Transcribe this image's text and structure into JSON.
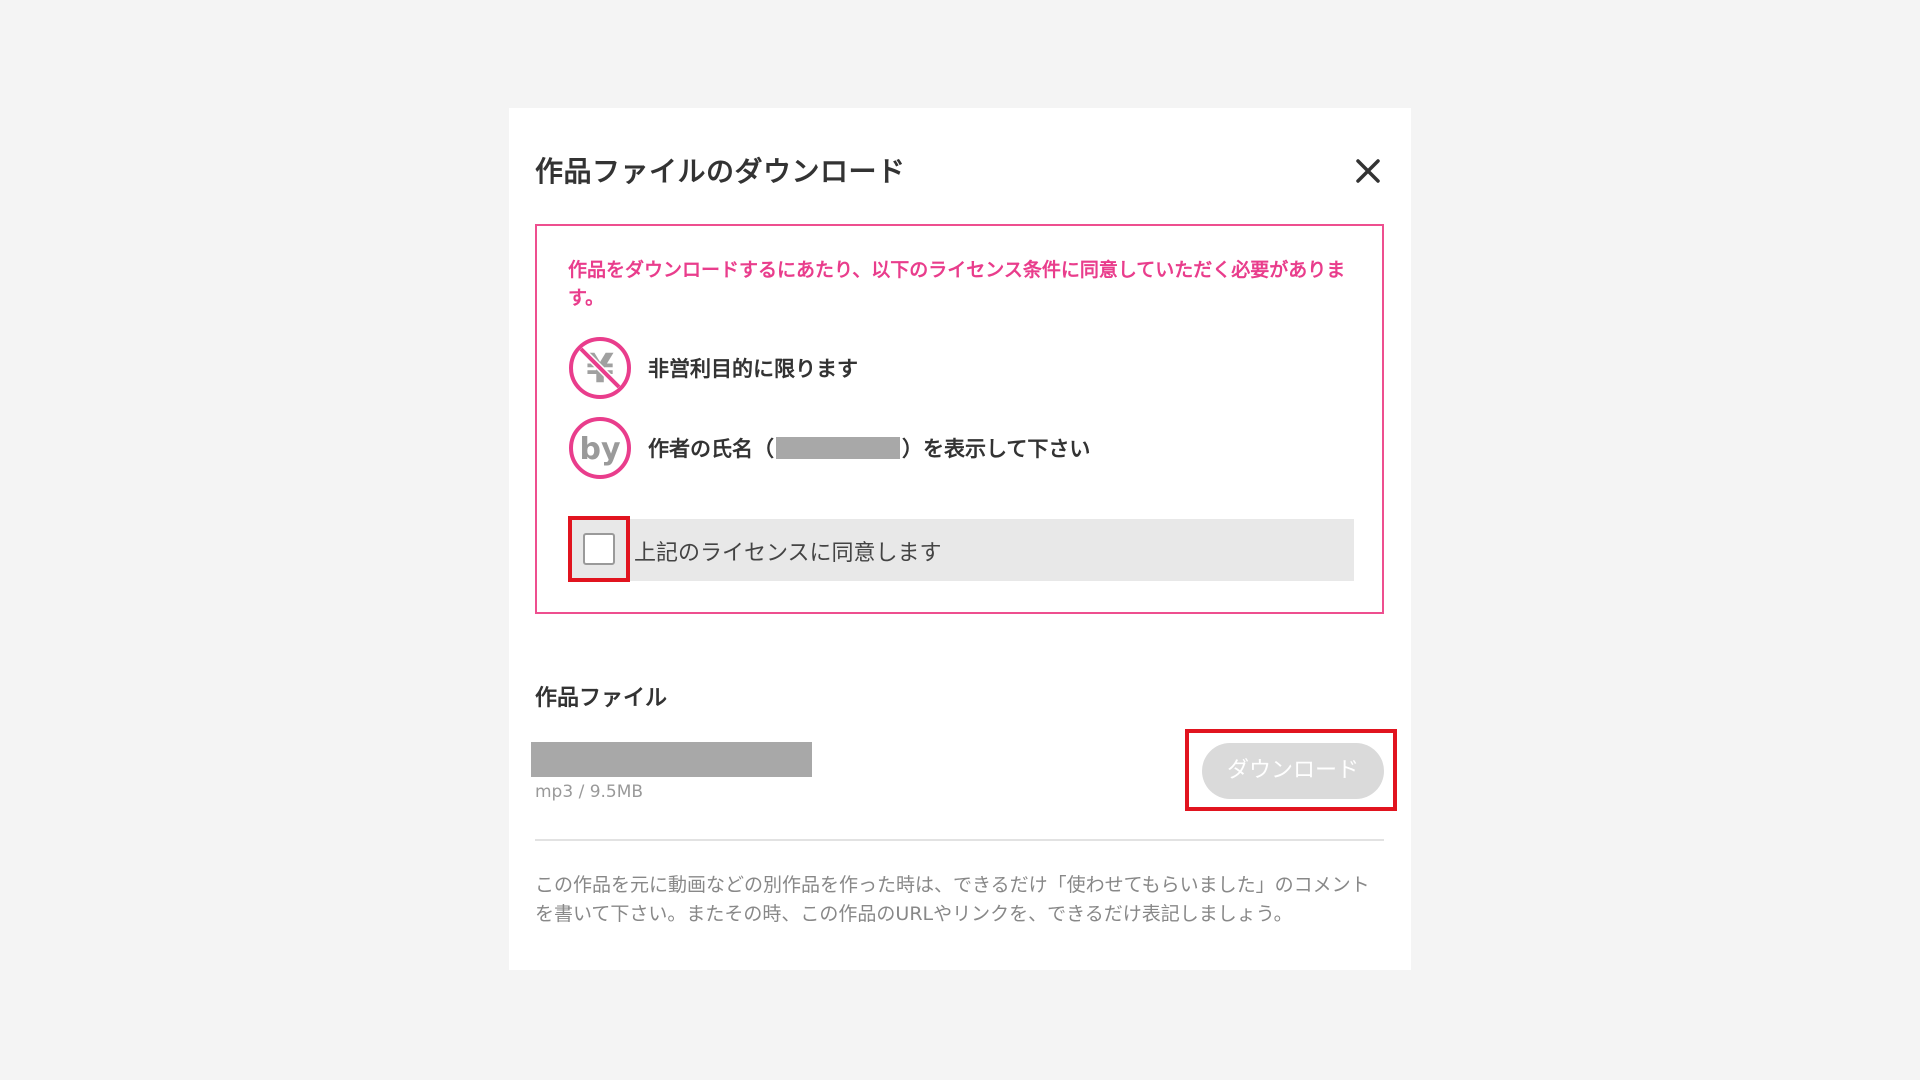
{
  "dialog": {
    "title": "作品ファイルのダウンロード",
    "close_icon": "close-icon"
  },
  "license": {
    "notice": "作品をダウンロードするにあたり、以下のライセンス条件に同意していただく必要があります。",
    "terms": [
      {
        "icon": "non-commercial-yen-icon",
        "text": "非営利目的に限ります"
      },
      {
        "icon": "attribution-by-icon",
        "text_before": "作者の氏名（",
        "text_after": "）を表示して下さい"
      }
    ],
    "agree_label": "上記のライセンスに同意します",
    "agree_checked": false
  },
  "files": {
    "heading": "作品ファイル",
    "items": [
      {
        "meta": "mp3 / 9.5MB",
        "download_label": "ダウンロード",
        "download_enabled": false
      }
    ]
  },
  "footer": {
    "note": "この作品を元に動画などの別作品を作った時は、できるだけ「使わせてもらいました」のコメントを書いて下さい。またその時、この作品のURLやリンクを、できるだけ表記しましょう。"
  },
  "colors": {
    "accent_pink": "#e93d8c",
    "highlight_red": "#e1141f",
    "disabled_button": "#dadada",
    "page_bg": "#f4f4f4"
  }
}
